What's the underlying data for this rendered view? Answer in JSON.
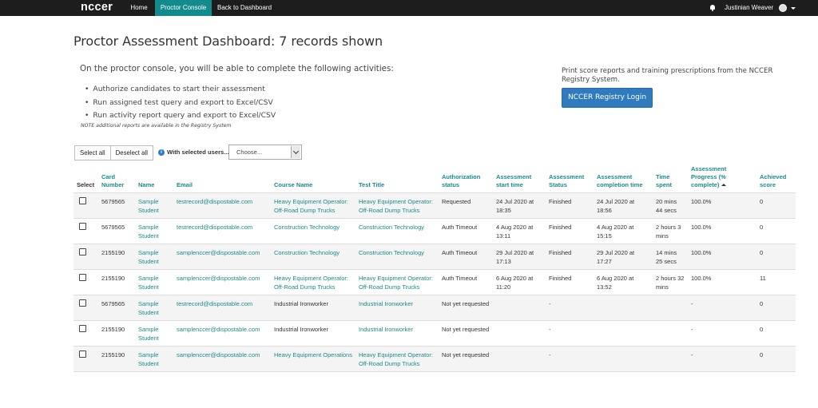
{
  "navbar": {
    "brand": "nccer",
    "links": [
      "Home",
      "Proctor Console",
      "Back to Dashboard"
    ],
    "user_name": "Justinian Weaver"
  },
  "header": {
    "title": "Proctor Assessment Dashboard: 7 records shown",
    "intro": "On the proctor console, you will be able to complete the following activities:",
    "bullets": [
      "Authorize candidates to start their assessment",
      "Run assigned test query and export to Excel/CSV",
      "Run activity report query and export to Excel/CSV"
    ],
    "note": "NOTE additional reports are available in the Registry System"
  },
  "registry": {
    "text": "Print score reports and training prescriptions from the NCCER Registry System.",
    "button": "NCCER Registry Login"
  },
  "toolbar": {
    "select_all": "Select all",
    "deselect_all": "Deselect all",
    "with_selected": "With selected users...",
    "choose": "Choose..."
  },
  "table": {
    "headers": [
      "Select",
      "Card Number",
      "Name",
      "Email",
      "Course Name",
      "Test Title",
      "Authorization status",
      "Assessment start time",
      "Assessment Status",
      "Assessment completion time",
      "Time spent",
      "Assessment Progress (% complete)",
      "Achieved score"
    ],
    "rows": [
      {
        "card": "5679565",
        "name": "Sample Student",
        "email": "testrecord@dispostable.com",
        "course": "Heavy Equipment Operator: Off-Road Dump Trucks",
        "test": "Heavy Equipment Operator: Off-Road Dump Trucks",
        "auth": "Requested",
        "start": "24 Jul 2020 at 18:35",
        "status": "Finished",
        "completion": "24 Jul 2020 at 18:56",
        "time": "20 mins 44 secs",
        "progress": "100.0%",
        "score": "0"
      },
      {
        "card": "5679565",
        "name": "Sample Student",
        "email": "testrecord@dispostable.com",
        "course": "Construction Technology",
        "test": "Construction Technology",
        "auth": "Auth Timeout",
        "start": "4 Aug 2020 at 13:11",
        "status": "Finished",
        "completion": "4 Aug 2020 at 15:15",
        "time": "2 hours 3 mins",
        "progress": "100.0%",
        "score": "0"
      },
      {
        "card": "2155190",
        "name": "Sample Student",
        "email": "samplenccer@dispostable.com",
        "course": "Construction Technology",
        "test": "Construction Technology",
        "auth": "Auth Timeout",
        "start": "29 Jul 2020 at 17:13",
        "status": "Finished",
        "completion": "29 Jul 2020 at 17:27",
        "time": "14 mins 25 secs",
        "progress": "100.0%",
        "score": "0"
      },
      {
        "card": "2155190",
        "name": "Sample Student",
        "email": "samplenccer@dispostable.com",
        "course": "Heavy Equipment Operator: Off-Road Dump Trucks",
        "test": "Heavy Equipment Operator: Off-Road Dump Trucks",
        "auth": "Auth Timeout",
        "start": "6 Aug 2020 at 11:20",
        "status": "Finished",
        "completion": "6 Aug 2020 at 13:52",
        "time": "2 hours 32 mins",
        "progress": "100.0%",
        "score": "11"
      },
      {
        "card": "5679565",
        "name": "Sample Student",
        "email": "testrecord@dispostable.com",
        "course": "Industrial Ironworker",
        "test": "Industrial Ironworker",
        "auth": "Not yet requested",
        "start": "",
        "status": "-",
        "completion": "",
        "time": "",
        "progress": "-",
        "score": "0"
      },
      {
        "card": "2155190",
        "name": "Sample Student",
        "email": "samplenccer@dispostable.com",
        "course": "Industrial Ironworker",
        "test": "Industrial Ironworker",
        "auth": "Not yet requested",
        "start": "",
        "status": "-",
        "completion": "",
        "time": "",
        "progress": "-",
        "score": "0"
      },
      {
        "card": "2155190",
        "name": "Sample Student",
        "email": "samplenccer@dispostable.com",
        "course": "Heavy Equipment Operations",
        "test": "Heavy Equipment Operator: Off-Road Dump Trucks",
        "auth": "Not yet requested",
        "start": "",
        "status": "-",
        "completion": "",
        "time": "",
        "progress": "-",
        "score": "0"
      }
    ],
    "course_link_rows": [
      0,
      1,
      2,
      3,
      6
    ]
  },
  "colors": {
    "navbar_bg": "#1d1d1d",
    "nav_active": "#138a8c",
    "link_teal": "#1a8a8c",
    "primary_button": "#2f7bbd"
  }
}
